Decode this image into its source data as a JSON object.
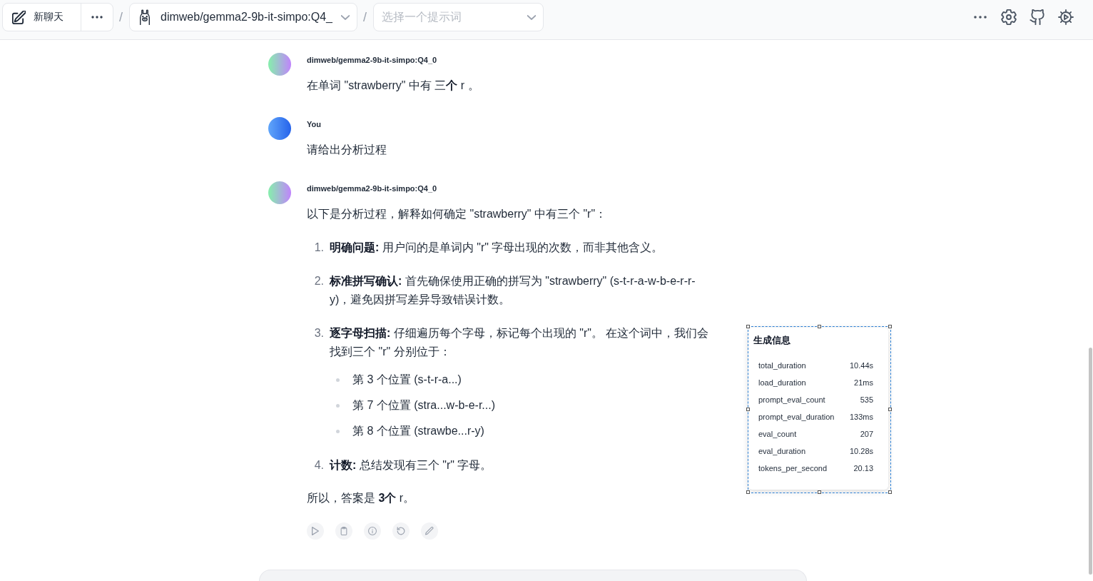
{
  "toolbar": {
    "new_chat": {
      "label": "新聊天"
    },
    "separators": [
      "/",
      "/"
    ],
    "model_select": {
      "value": "dimweb/gemma2-9b-it-simpo:Q4_"
    },
    "prompt_select": {
      "placeholder": "选择一个提示词"
    }
  },
  "messages": [
    {
      "kind": "assistant",
      "author": "dimweb/gemma2-9b-it-simpo:Q4_0",
      "blocks": [
        {
          "kind": "paragraph",
          "text": "在单词 \"strawberry\" 中有 三**个** r 。"
        }
      ]
    },
    {
      "kind": "user",
      "author": "You",
      "blocks": [
        {
          "kind": "paragraph",
          "text": "请给出分析过程"
        }
      ]
    },
    {
      "kind": "assistant",
      "author": "dimweb/gemma2-9b-it-simpo:Q4_0",
      "blocks": [
        {
          "kind": "paragraph",
          "text": "以下是分析过程，解释如何确定 \"strawberry\" 中有三个 \"r\"："
        },
        {
          "kind": "ordered_list",
          "items": [
            {
              "marker": "1.",
              "text": "**明确问题:** 用户问的是单词内 \"r\" 字母出现的次数，而非其他含义。"
            },
            {
              "marker": "2.",
              "text": "**标准拼写确认:** 首先确保使用正确的拼写为 \"strawberry\" (s-t-r-a-w-b-e-r-r-y)，避免因拼写差异导致错误计数。"
            },
            {
              "marker": "3.",
              "text": "**逐字母扫描:** 仔细遍历每个字母，标记每个出现的 \"r\"。 在这个词中，我们会找到三个 \"r\" 分别位于：",
              "children": [
                {
                  "text": "第 3 个位置 (s-t-r-a...)"
                },
                {
                  "text": "第 7 个位置 (stra...w-b-e-r...)"
                },
                {
                  "text": "第 8 个位置 (strawbe...r-y)"
                }
              ]
            },
            {
              "marker": "4.",
              "text": "**计数:** 总结发现有三个 \"r\" 字母。"
            }
          ]
        },
        {
          "kind": "paragraph",
          "text": "所以，答案是 **3个** r。"
        }
      ]
    }
  ],
  "generation_info": {
    "selected": true,
    "title": "生成信息",
    "rows": [
      {
        "name": "total_duration",
        "value": "10.44s"
      },
      {
        "name": "load_duration",
        "value": "21ms"
      },
      {
        "name": "prompt_eval_count",
        "value": "535"
      },
      {
        "name": "prompt_eval_duration",
        "value": "133ms"
      },
      {
        "name": "eval_count",
        "value": "207"
      },
      {
        "name": "eval_duration",
        "value": "10.28s"
      },
      {
        "name": "tokens_per_second",
        "value": "20.13"
      }
    ]
  }
}
